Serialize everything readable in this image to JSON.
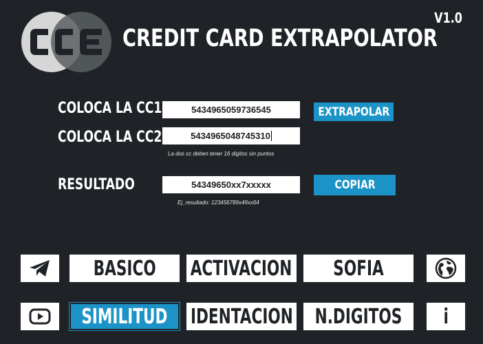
{
  "app": {
    "title": "CREDIT CARD EXTRAPOLATOR",
    "version": "V1.0",
    "logo_text": "CCE"
  },
  "form": {
    "cc1_label": "COLOCA LA CC1",
    "cc1_value": "5434965059736545",
    "cc2_label": "COLOCA LA CC2",
    "cc2_value": "5434965048745310",
    "hint": "La dos cc deben tener 16 digitos sin puntos",
    "extrapolar_label": "EXTRAPOLAR",
    "result_label": "RESULTADO",
    "result_value": "54349650xx7xxxxx",
    "copiar_label": "COPIAR",
    "example": "Ej_resultado: 123456789x49xx64"
  },
  "nav": {
    "row1": [
      "BASICO",
      "ACTIVACION",
      "SOFIA"
    ],
    "row2": [
      "SIMILITUD",
      "IDENTACION",
      "N.DIGITOS"
    ],
    "active": "SIMILITUD",
    "info_label": "i"
  },
  "colors": {
    "background": "#1f2226",
    "accent": "#1c93c7"
  },
  "icons": {
    "telegram": "telegram-icon",
    "globe": "globe-icon",
    "youtube": "youtube-icon",
    "info": "info-icon"
  }
}
